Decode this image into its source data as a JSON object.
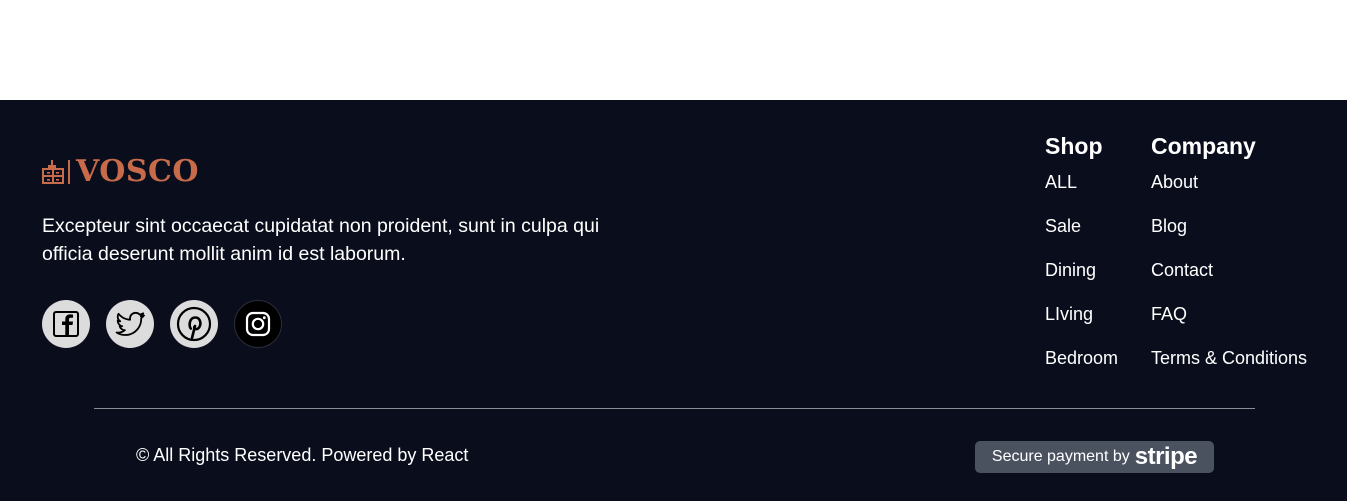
{
  "brand": {
    "name": "VOSCO",
    "icon": "dresser-icon",
    "color": "#c86b4b"
  },
  "tagline": "Excepteur sint occaecat cupidatat non proident, sunt in culpa qui officia deserunt mollit anim id est laborum.",
  "social": [
    {
      "icon": "facebook-icon"
    },
    {
      "icon": "twitter-icon"
    },
    {
      "icon": "pinterest-icon"
    },
    {
      "icon": "instagram-icon"
    }
  ],
  "shop": {
    "title": "Shop",
    "links": [
      "ALL",
      "Sale",
      "Dining",
      "LIving",
      "Bedroom"
    ]
  },
  "company": {
    "title": "Company",
    "links": [
      "About",
      "Blog",
      "Contact",
      "FAQ",
      "Terms & Conditions"
    ]
  },
  "copyright": "© All Rights Reserved. Powered by React",
  "payment": {
    "prefix": "Secure payment by",
    "provider": "stripe"
  },
  "colors": {
    "footer_bg": "#0a0e1c",
    "accent": "#c86b4b",
    "badge_bg": "#4a5260"
  }
}
